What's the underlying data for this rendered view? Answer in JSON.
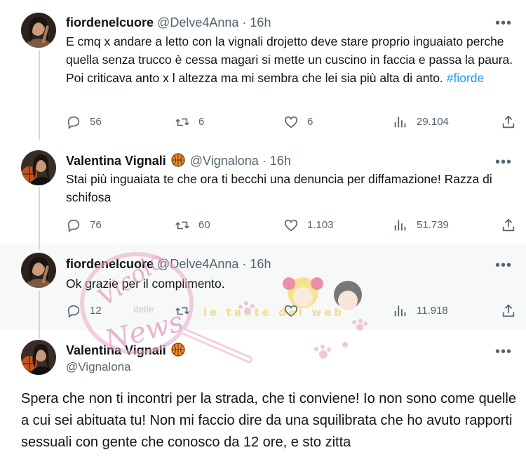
{
  "tweets": [
    {
      "display_name": "fiordenelcuore",
      "handle": "@Delve4Anna",
      "dot": "·",
      "time": "16h",
      "text_part": "E cmq x andare a letto con la vignali drojetto deve stare proprio inguaiato perche quella senza trucco è  cessa magari si mette un cuscino in faccia e passa la paura. Poi criticava anto x l altezza ma mi sembra che lei sia più alta di anto. ",
      "hashtag": "#fiorde",
      "replies": "56",
      "retweets": "6",
      "likes": "6",
      "views": "29.104"
    },
    {
      "display_name": "Valentina Vignali",
      "handle": "@Vignalona",
      "dot": "·",
      "time": "16h",
      "text": "Stai più inguaiata te che ora ti becchi una denuncia per diffamazione! Razza di schifosa",
      "replies": "76",
      "retweets": "60",
      "likes": "1.103",
      "views": "51.739"
    },
    {
      "display_name": "fiordenelcuore",
      "handle": "@Delve4Anna",
      "dot": "·",
      "time": "16h",
      "text": "Ok grazie per il complimento.",
      "replies": "12",
      "views": "11.918"
    }
  ],
  "focused": {
    "display_name": "Valentina Vignali",
    "handle": "@Vignalona",
    "text": "Spera che non ti incontri per la strada, che ti conviene! Io non sono come quelle a cui sei abituata tu! Non mi faccio dire da una squilibrata che ho avuto rapporti sessuali con gente che conosco da 12 ore, e sto zitta"
  },
  "more_glyph": "•••",
  "watermark": {
    "line1": "Vicolo",
    "line2": "delle",
    "line3": "News",
    "banner": "le tante del web"
  },
  "colors": {
    "text": "#0f1419",
    "secondary": "#536471",
    "hashtag": "#1d9bf0",
    "thread_line": "#cfd9de",
    "highlight_bg": "#f7f9f9",
    "divider": "#eff3f4"
  }
}
